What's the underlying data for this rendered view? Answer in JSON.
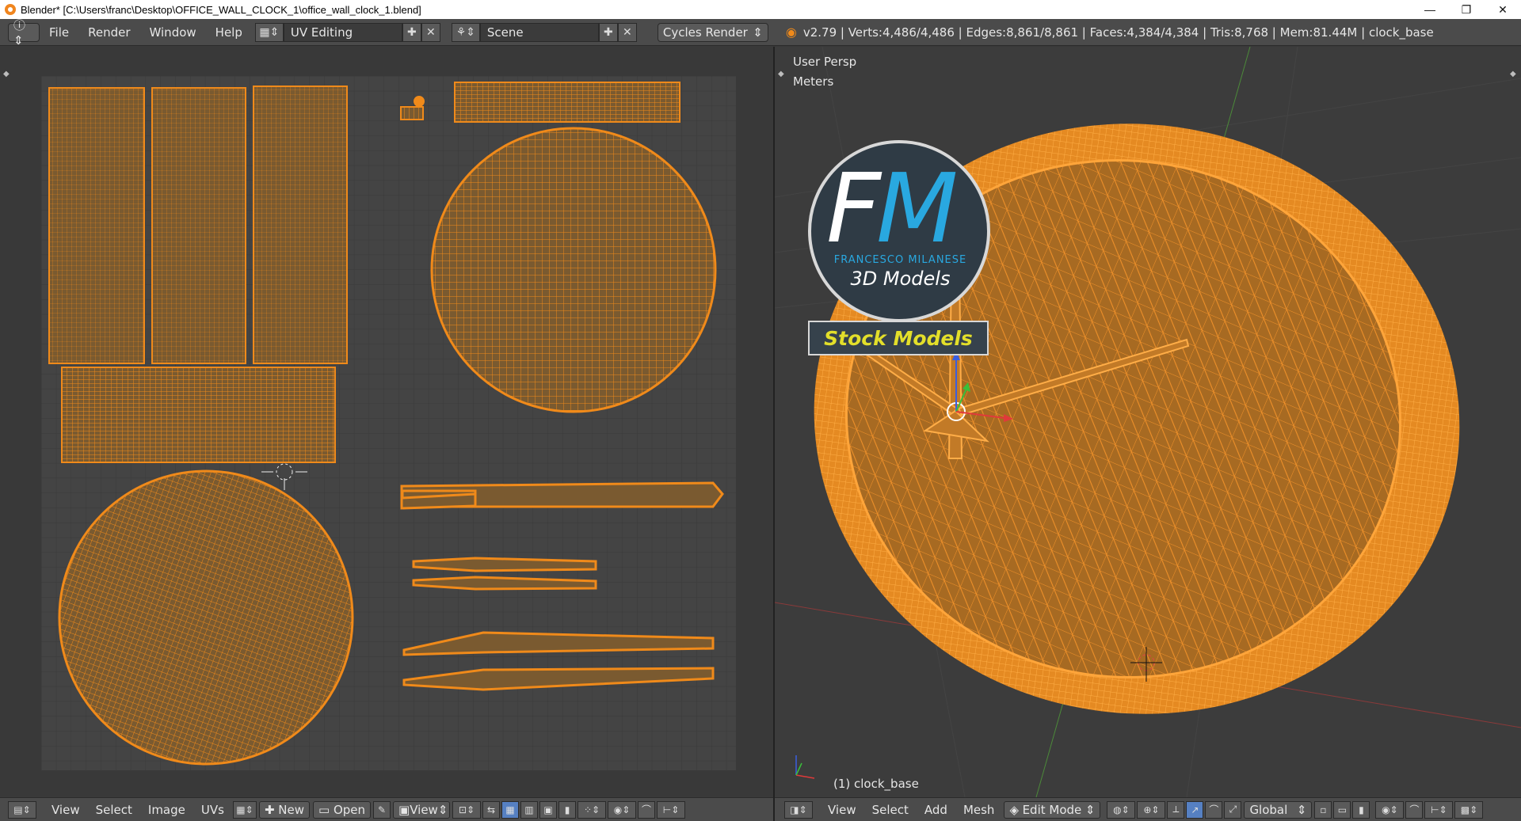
{
  "window": {
    "title": "Blender* [C:\\Users\\franc\\Desktop\\OFFICE_WALL_CLOCK_1\\office_wall_clock_1.blend]",
    "controls": [
      "—",
      "❐",
      "✕"
    ]
  },
  "info_header": {
    "menus": [
      "File",
      "Render",
      "Window",
      "Help"
    ],
    "screen_layout": "UV Editing",
    "scene": "Scene",
    "render_engine": "Cycles Render",
    "stats": "v2.79 | Verts:4,486/4,486 | Edges:8,861/8,861 | Faces:4,384/4,384 | Tris:8,768 | Mem:81.44M | clock_base"
  },
  "uv_editor": {
    "header": {
      "menus": [
        "View",
        "Select",
        "Image",
        "UVs"
      ],
      "new_label": "New",
      "open_label": "Open",
      "view_label": "View"
    }
  },
  "viewport": {
    "view_name": "User Persp",
    "units": "Meters",
    "object_label": "(1) clock_base",
    "header": {
      "menus": [
        "View",
        "Select",
        "Add",
        "Mesh"
      ],
      "mode": "Edit Mode",
      "orientation": "Global"
    }
  },
  "watermark": {
    "name": "FRANCESCO MILANESE",
    "subtitle": "3D Models",
    "banner": "Stock Models"
  },
  "colors": {
    "uv_orange": "#f08a1a",
    "face_fill": "#7a5a30",
    "grid_bg": "#444444",
    "logo_blue": "#29a8e0",
    "logo_yellow": "#e3df2a"
  }
}
